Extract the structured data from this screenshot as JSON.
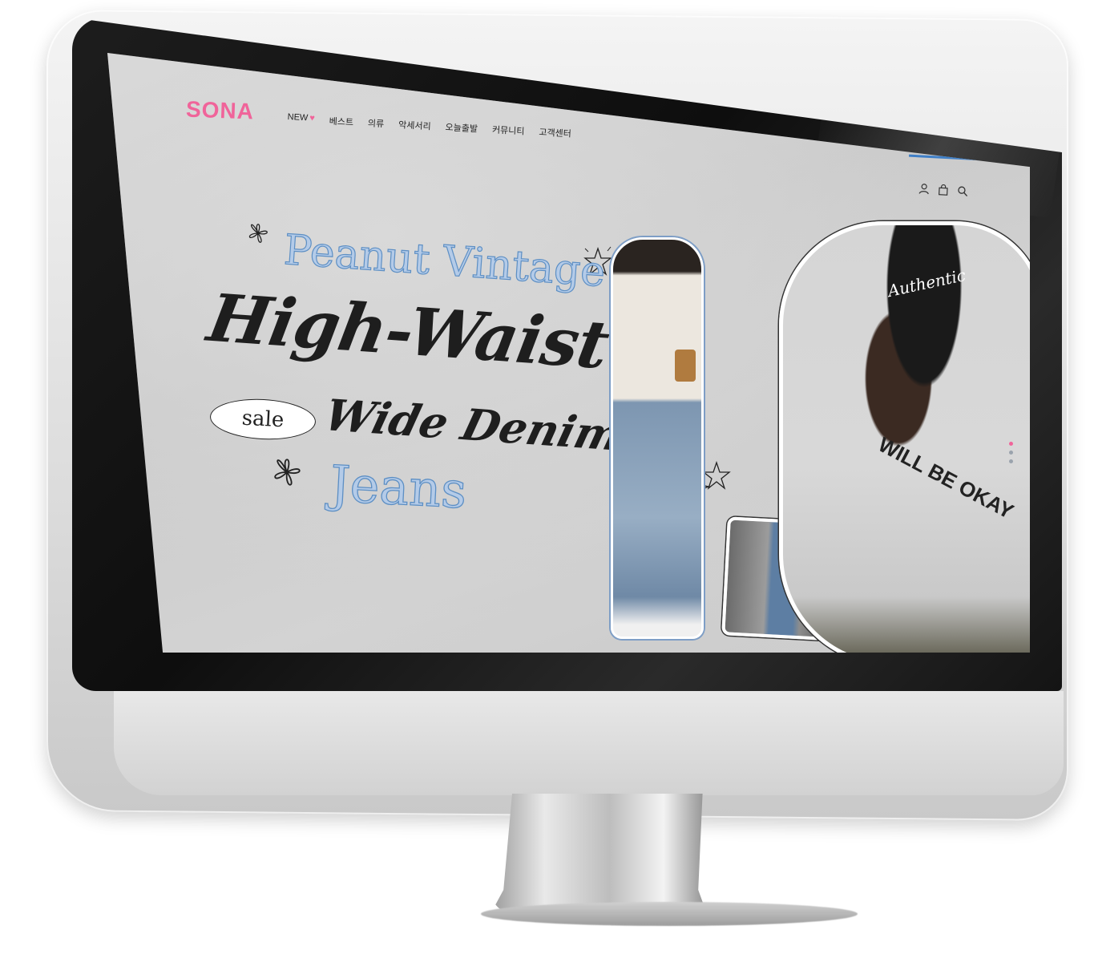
{
  "site": {
    "logo": "SONA",
    "brand_color": "#f0649a"
  },
  "nav": {
    "items": [
      {
        "label": "NEW",
        "badge_icon": "heart-icon"
      },
      {
        "label": "베스트"
      },
      {
        "label": "의류"
      },
      {
        "label": "악세서리"
      },
      {
        "label": "오늘출발"
      },
      {
        "label": "커뮤니티"
      },
      {
        "label": "고객센터"
      }
    ]
  },
  "header_icons": [
    "user-icon",
    "shopping-bag-icon",
    "search-icon"
  ],
  "hero": {
    "line1": "Peanut Vintage",
    "line2": "High-Waist",
    "sale_badge": "sale",
    "line3": "Wide Denim",
    "line4": "Jeans",
    "accent_color": "#5d8fc4"
  },
  "photos": {
    "cap_text": "Authentic",
    "shirt_text": "WILL BE OKAY"
  },
  "slider": {
    "total": 3,
    "active": 1
  }
}
